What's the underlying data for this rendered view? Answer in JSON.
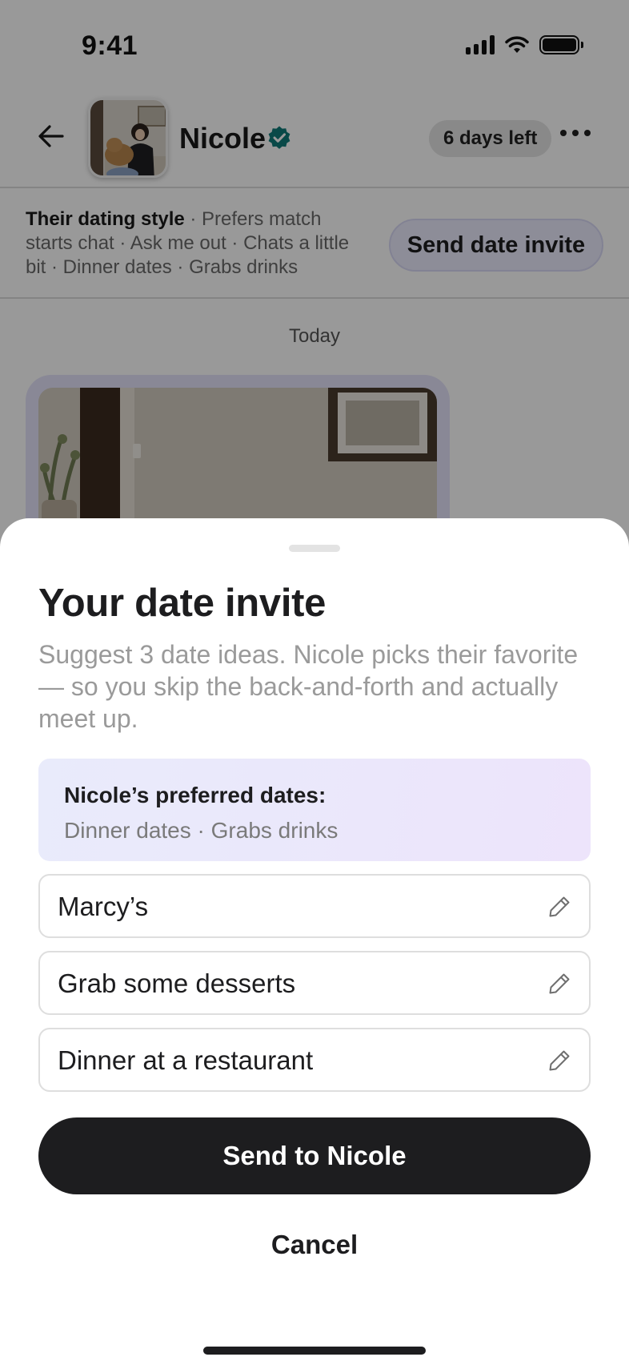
{
  "status_bar": {
    "time": "9:41",
    "signal_icon": "cellular-signal-icon",
    "wifi_icon": "wifi-icon",
    "battery_icon": "battery-icon"
  },
  "chat_header": {
    "back_icon": "arrow-left-icon",
    "name": "Nicole",
    "verified_icon": "verified-badge-icon",
    "days_left": "6 days left",
    "more_icon": "more-horizontal-icon"
  },
  "dating_style": {
    "label": "Their dating style",
    "details": " · Prefers match starts chat · Ask me out · Chats a little bit · Dinner dates · Grabs drinks",
    "send_invite_label": "Send date invite"
  },
  "chat": {
    "date_separator": "Today"
  },
  "sheet": {
    "title": "Your date invite",
    "description": "Suggest 3 date ideas. Nicole picks their favorite — so you skip the back-and-forth and actually meet up.",
    "preferences": {
      "title": "Nicole’s preferred dates:",
      "values": "Dinner dates · Grabs drinks"
    },
    "ideas": [
      {
        "text": "Marcy’s",
        "icon": "pencil-edit-icon"
      },
      {
        "text": "Grab some desserts",
        "icon": "pencil-edit-icon"
      },
      {
        "text": "Dinner at a restaurant",
        "icon": "pencil-edit-icon"
      }
    ],
    "send_label": "Send to Nicole",
    "cancel_label": "Cancel"
  },
  "colors": {
    "primary_button": "#1d1d1f",
    "verified_badge": "#0f7a78",
    "preference_bg": "#ebe8fb",
    "invite_pill_bg": "#ececfd"
  }
}
